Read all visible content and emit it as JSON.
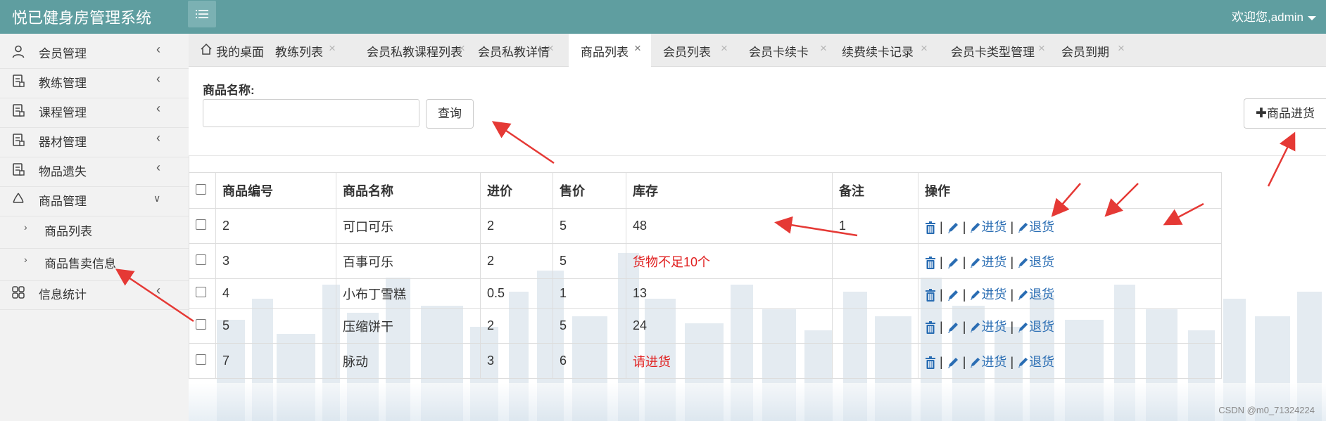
{
  "app": {
    "title": "悦已健身房管理系统",
    "welcome": "欢迎您,admin"
  },
  "sidebar": {
    "items": [
      {
        "label": "会员管理",
        "icon": "user-icon"
      },
      {
        "label": "教练管理",
        "icon": "document-icon"
      },
      {
        "label": "课程管理",
        "icon": "document-icon"
      },
      {
        "label": "器材管理",
        "icon": "document-icon"
      },
      {
        "label": "物品遗失",
        "icon": "document-icon"
      },
      {
        "label": "商品管理",
        "icon": "recycle-icon"
      },
      {
        "label": "信息统计",
        "icon": "grid-icon"
      }
    ],
    "sub_items": [
      {
        "label": "商品列表"
      },
      {
        "label": "商品售卖信息"
      }
    ]
  },
  "tabs": [
    {
      "label": "我的桌面",
      "icon": "home-icon"
    },
    {
      "label": "教练列表"
    },
    {
      "label": "会员私教课程列表"
    },
    {
      "label": "会员私教详情"
    },
    {
      "label": "商品列表",
      "active": true
    },
    {
      "label": "会员列表"
    },
    {
      "label": "会员卡续卡"
    },
    {
      "label": "续费续卡记录"
    },
    {
      "label": "会员卡类型管理"
    },
    {
      "label": "会员到期"
    }
  ],
  "search": {
    "label": "商品名称:",
    "value": "",
    "query_button": "查询",
    "purchase_button": "商品进货"
  },
  "table": {
    "headers": [
      "商品编号",
      "商品名称",
      "进价",
      "售价",
      "库存",
      "备注",
      "操作"
    ],
    "rows": [
      {
        "id": "2",
        "name": "可口可乐",
        "cost": "2",
        "price": "5",
        "stock": "48",
        "stock_alert": false,
        "note": "1"
      },
      {
        "id": "3",
        "name": "百事可乐",
        "cost": "2",
        "price": "5",
        "stock": "货物不足10个",
        "stock_alert": true,
        "note": ""
      },
      {
        "id": "4",
        "name": "小布丁雪糕",
        "cost": "0.5",
        "price": "1",
        "stock": "13",
        "stock_alert": false,
        "note": ""
      },
      {
        "id": "5",
        "name": "压缩饼干",
        "cost": "2",
        "price": "5",
        "stock": "24",
        "stock_alert": false,
        "note": ""
      },
      {
        "id": "7",
        "name": "脉动",
        "cost": "3",
        "price": "6",
        "stock": "请进货",
        "stock_alert": true,
        "note": ""
      }
    ],
    "op_labels": {
      "separator": "|",
      "purchase": "进货",
      "return": "退货"
    }
  },
  "watermark": "CSDN @m0_71324224",
  "colors": {
    "header": "#5f9ea0",
    "link": "#2a6db3",
    "alert": "#e02020",
    "annotation_arrow": "#e53935"
  }
}
